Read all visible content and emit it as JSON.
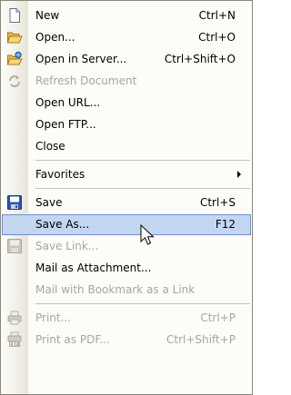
{
  "menu": {
    "items": [
      {
        "label": "New",
        "shortcut": "Ctrl+N",
        "icon": "new-document-icon"
      },
      {
        "label": "Open...",
        "shortcut": "Ctrl+O",
        "icon": "open-folder-icon"
      },
      {
        "label": "Open in Server...",
        "shortcut": "Ctrl+Shift+O",
        "icon": "server-folder-icon"
      },
      {
        "label": "Refresh Document",
        "icon": "refresh-icon"
      },
      {
        "label": "Open URL..."
      },
      {
        "label": "Open FTP..."
      },
      {
        "label": "Close"
      },
      {
        "label": "Favorites"
      },
      {
        "label": "Save",
        "shortcut": "Ctrl+S",
        "icon": "save-disk-icon"
      },
      {
        "label": "Save As...",
        "shortcut": "F12"
      },
      {
        "label": "Save Link...",
        "icon": "save-link-disk-icon"
      },
      {
        "label": "Mail as Attachment..."
      },
      {
        "label": "Mail with Bookmark as a Link"
      },
      {
        "label": "Print...",
        "shortcut": "Ctrl+P",
        "icon": "printer-icon"
      },
      {
        "label": "Print as PDF...",
        "shortcut": "Ctrl+Shift+P",
        "icon": "pdf-printer-icon"
      }
    ]
  },
  "colors": {
    "highlight": "#c2d6f2",
    "highlight_border": "#6f8fcb",
    "disabled_text": "#a7a698"
  }
}
